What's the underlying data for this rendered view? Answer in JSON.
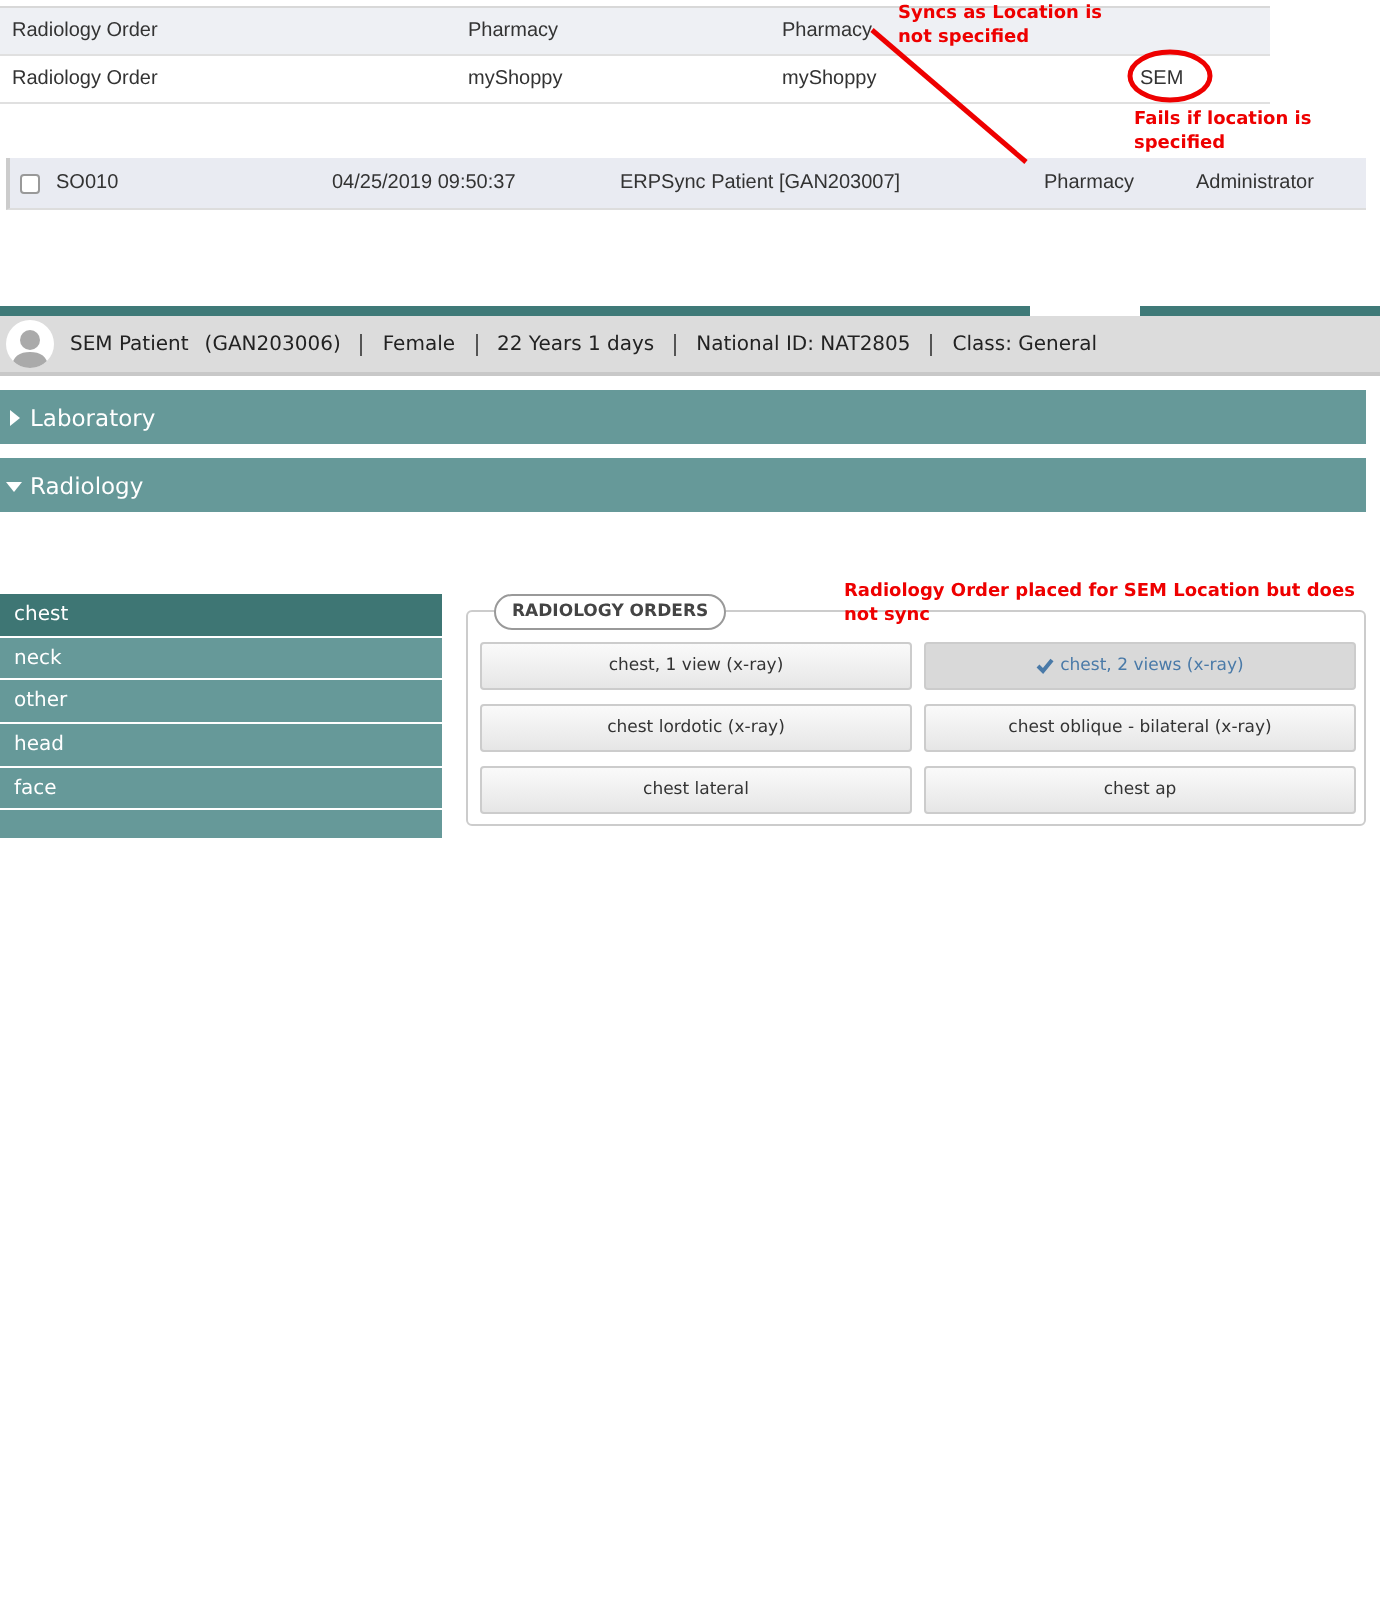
{
  "sync_table": {
    "rows": [
      {
        "cells": [
          "Radiology Order",
          "Pharmacy",
          "Pharmacy"
        ],
        "shaded": true
      },
      {
        "cells": [
          "Radiology Order",
          "myShoppy",
          "myShoppy",
          "SEM"
        ],
        "shaded": false
      }
    ]
  },
  "order_list": {
    "rows": [
      {
        "checked": false,
        "cells": [
          "SO010",
          "04/25/2019 09:50:37",
          "ERPSync Patient [GAN203007]",
          "Pharmacy",
          "Administrator"
        ]
      }
    ]
  },
  "annotations": [
    {
      "kind": "note",
      "text": "Syncs as Location is not specified"
    },
    {
      "kind": "note",
      "text": "Fails if location is specified"
    },
    {
      "kind": "note",
      "text": "Radiology Order placed for SEM Location but does not sync"
    }
  ],
  "patient": {
    "name": "SEM Patient",
    "id": "(GAN203006)",
    "fields": [
      "Female",
      "22 Years 1 days",
      "National ID: NAT2805",
      "Class: General"
    ]
  },
  "sections": [
    {
      "label": "Laboratory",
      "expanded": false
    },
    {
      "label": "Radiology",
      "expanded": true
    }
  ],
  "sidebar": {
    "items": [
      {
        "label": "chest",
        "selected": true
      },
      {
        "label": "neck",
        "selected": false
      },
      {
        "label": "other",
        "selected": false
      },
      {
        "label": "head",
        "selected": false
      },
      {
        "label": "face",
        "selected": false
      }
    ]
  },
  "orders": {
    "title": "RADIOLOGY ORDERS",
    "buttons": [
      {
        "label": "chest, 1 view (x-ray)",
        "selected": false
      },
      {
        "label": "chest, 2 views (x-ray)",
        "selected": true
      },
      {
        "label": "chest lordotic (x-ray)",
        "selected": false
      },
      {
        "label": "chest oblique - bilateral (x-ray)",
        "selected": false
      },
      {
        "label": "chest lateral",
        "selected": false
      },
      {
        "label": "chest ap",
        "selected": false
      }
    ]
  }
}
